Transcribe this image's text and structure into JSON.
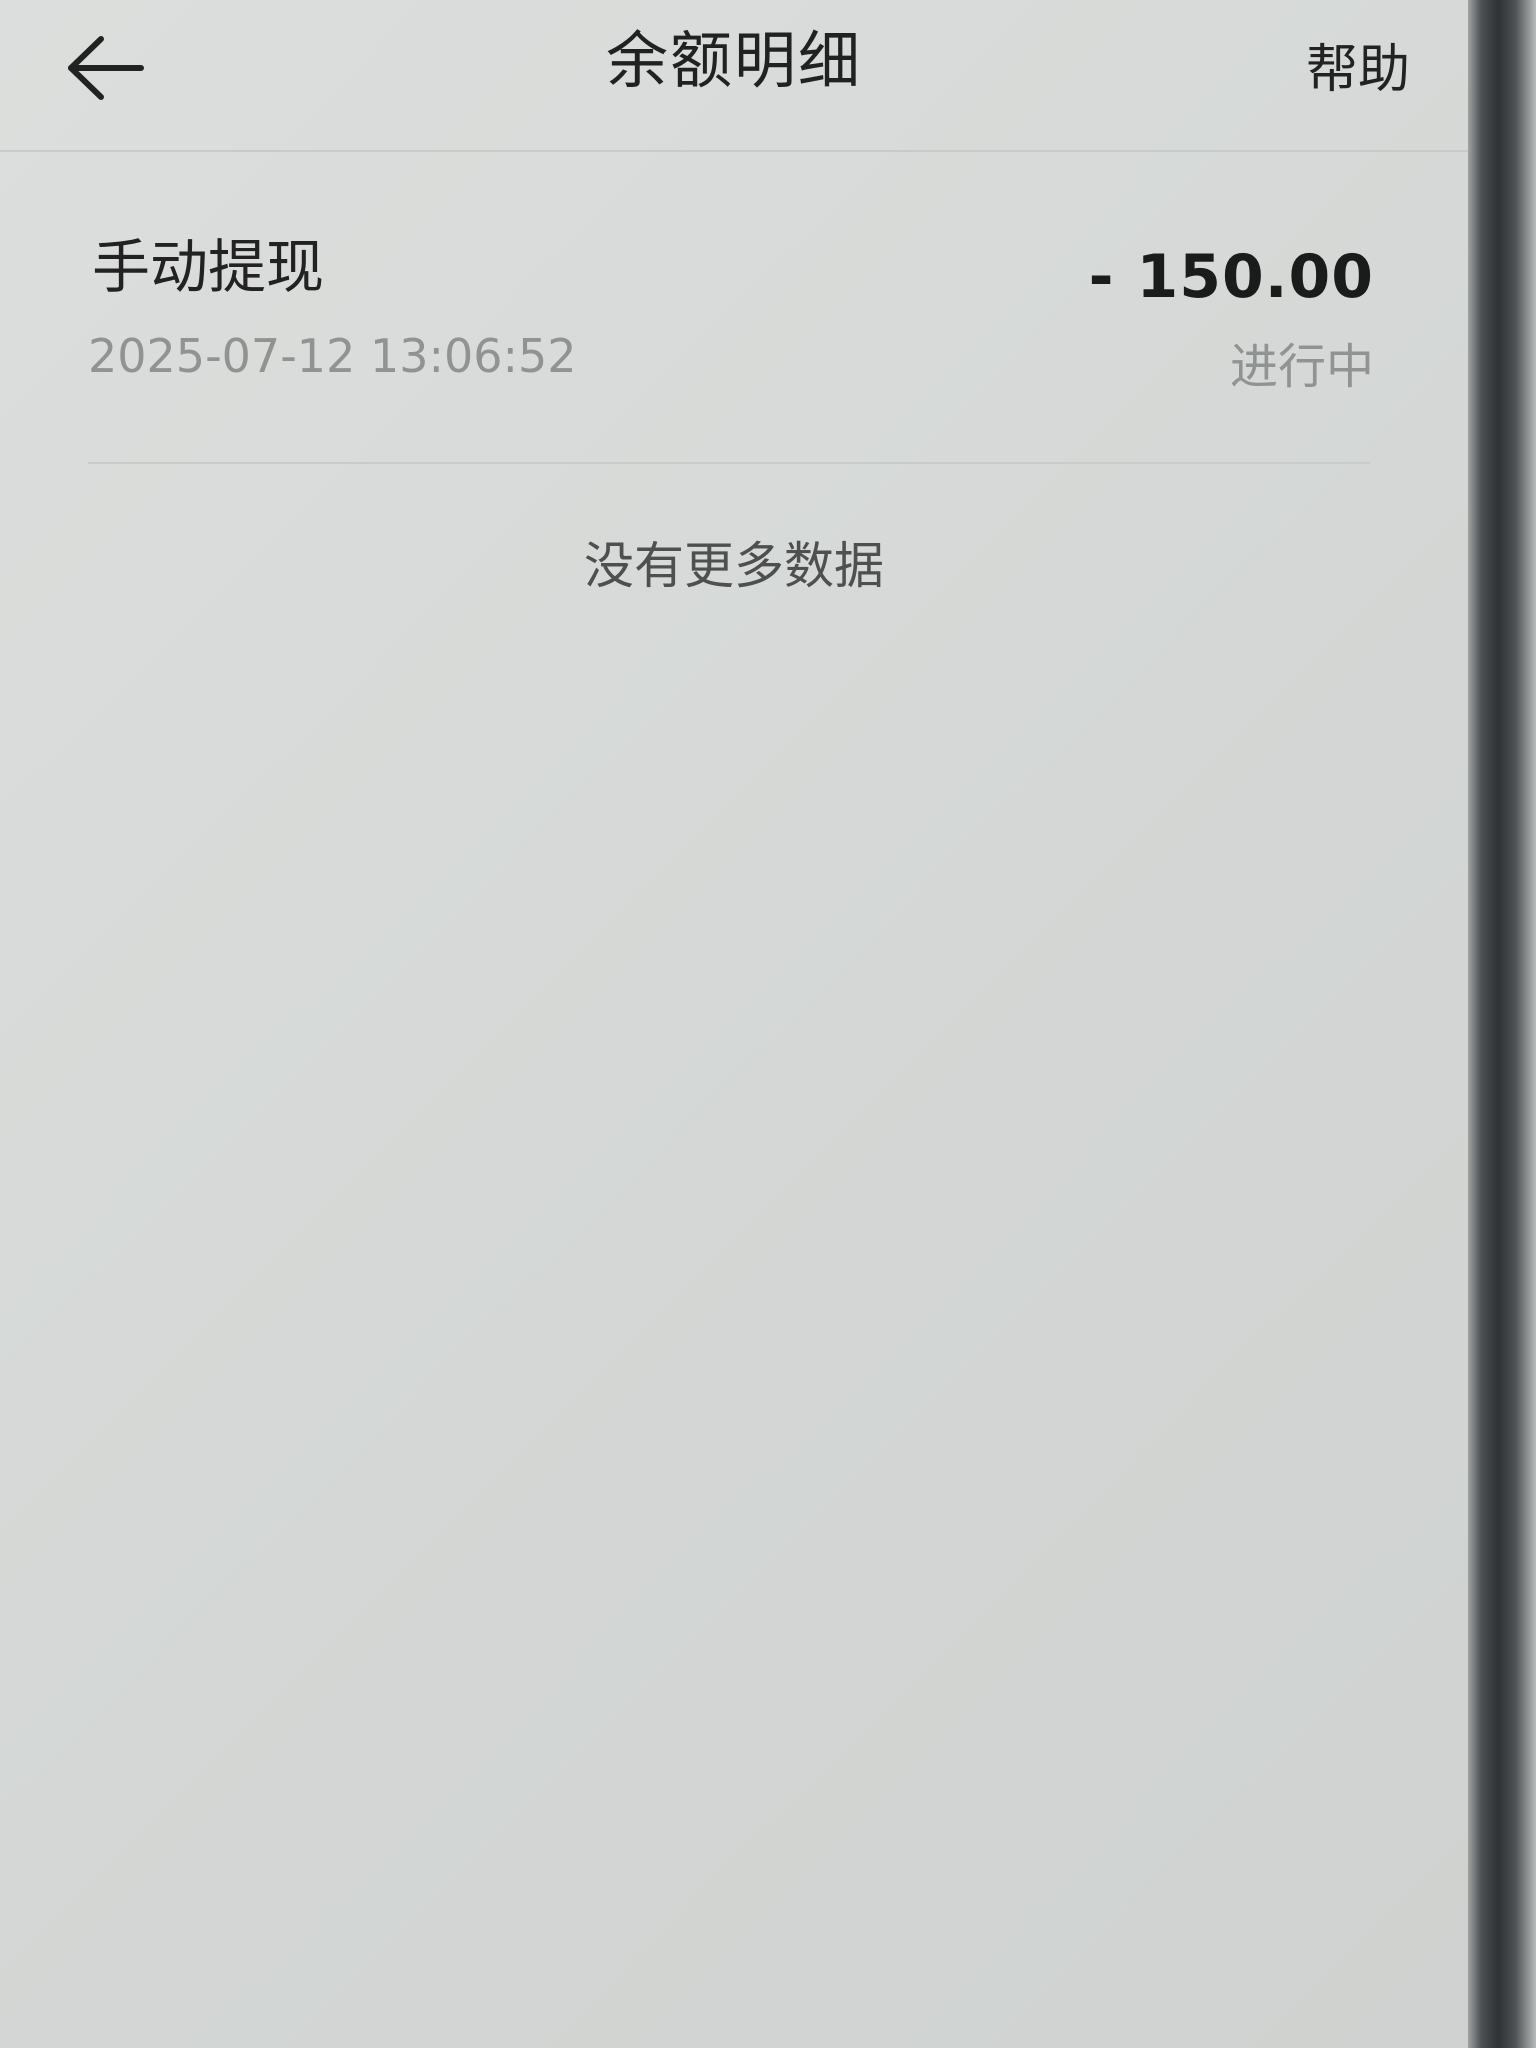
{
  "header": {
    "back_icon": "arrow-left-icon",
    "title": "余额明细",
    "help_label": "帮助"
  },
  "records": [
    {
      "title": "手动提现",
      "time": "2025-07-12 13:06:52",
      "amount": "- 150.00",
      "status": "进行中"
    }
  ],
  "list_footer": "没有更多数据",
  "colors": {
    "background": "#d8dbd9",
    "primary_text": "#222222",
    "secondary_text": "#8f9391"
  }
}
